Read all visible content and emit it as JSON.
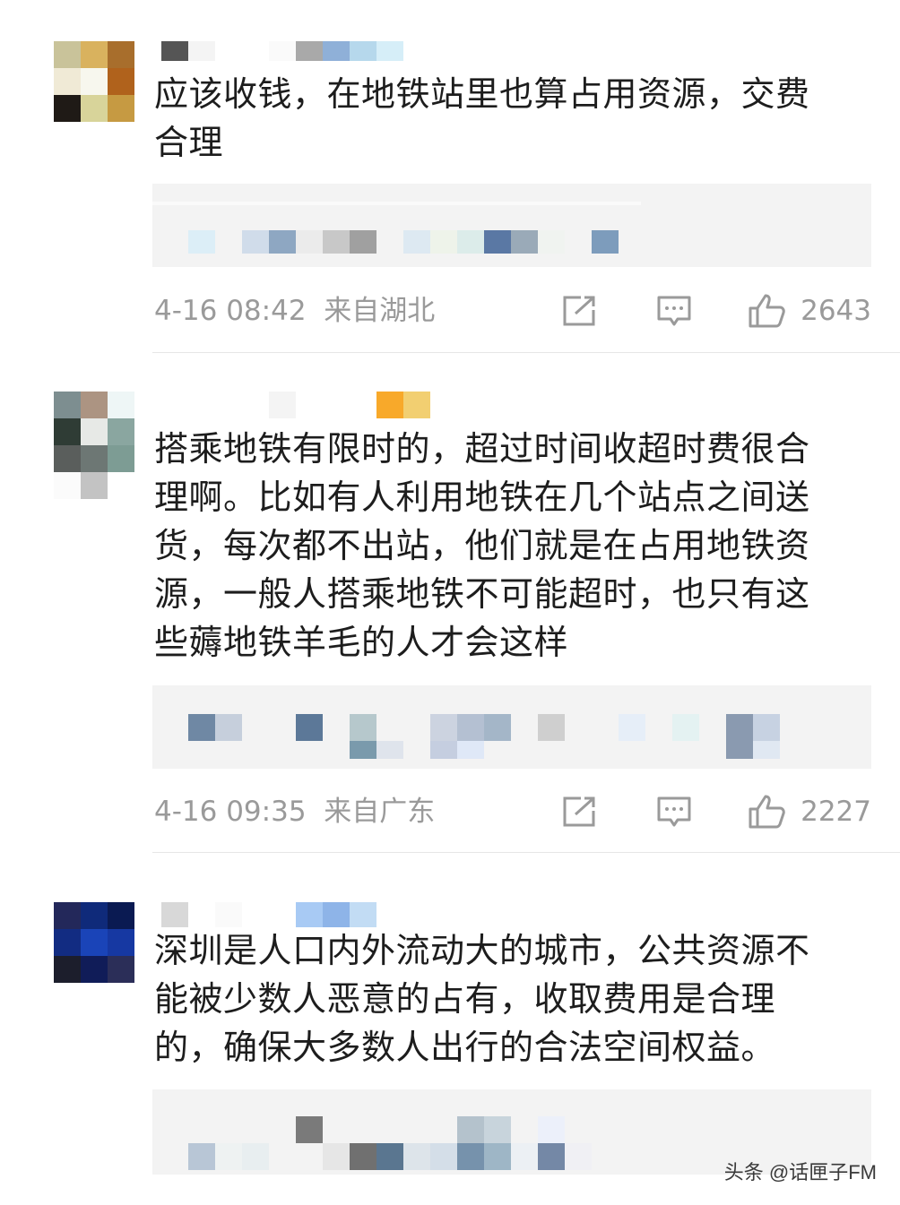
{
  "comments": [
    {
      "text": "应该收钱，在地铁站里也算占用资源，交费\n合理",
      "time": "4-16 08:42",
      "location": "来自湖北",
      "likes": "2643"
    },
    {
      "text": "搭乘地铁有限时的，超过时间收超时费很合\n理啊。比如有人利用地铁在几个站点之间送\n货，每次都不出站，他们就是在占用地铁资\n源，一般人搭乘地铁不可能超时，也只有这\n些薅地铁羊毛的人才会这样",
      "time": "4-16 09:35",
      "location": "来自广东",
      "likes": "2227"
    },
    {
      "text": "深圳是人口内外流动大的城市，公共资源不\n能被少数人恶意的占有，收取费用是合理\n的，确保大多数人出行的合法空间权益。"
    }
  ],
  "icons": {
    "share": "share-icon",
    "reply": "comment-icon",
    "like": "thumbs-up-icon"
  },
  "colors": {
    "text": "#1d1d1d",
    "meta": "#9a9a9a",
    "quote_bg": "#f3f3f3"
  },
  "watermark": "头条 @话匣子FM"
}
